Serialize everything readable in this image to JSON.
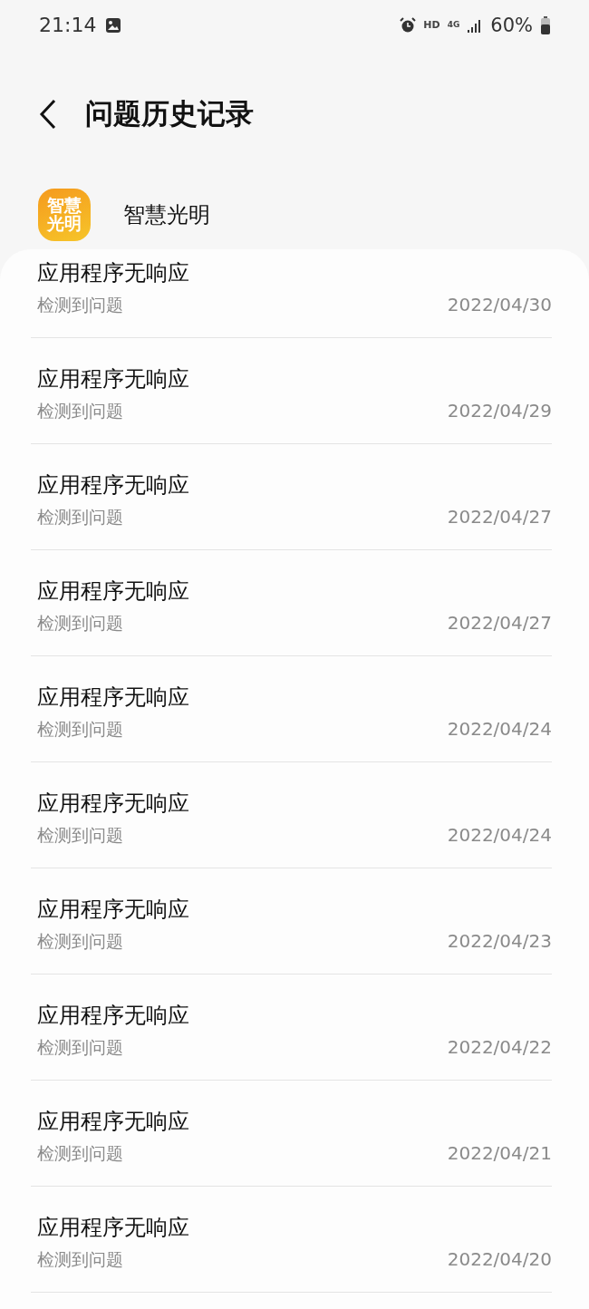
{
  "status_bar": {
    "time": "21:14",
    "network": "HD",
    "network_type": "4G",
    "battery": "60%"
  },
  "header": {
    "title": "问题历史记录"
  },
  "app": {
    "icon_lines": [
      "智慧",
      "光明"
    ],
    "name": "智慧光明"
  },
  "records": [
    {
      "title": "应用程序无响应",
      "subtitle": "检测到问题",
      "date": "2022/04/30"
    },
    {
      "title": "应用程序无响应",
      "subtitle": "检测到问题",
      "date": "2022/04/29"
    },
    {
      "title": "应用程序无响应",
      "subtitle": "检测到问题",
      "date": "2022/04/27"
    },
    {
      "title": "应用程序无响应",
      "subtitle": "检测到问题",
      "date": "2022/04/27"
    },
    {
      "title": "应用程序无响应",
      "subtitle": "检测到问题",
      "date": "2022/04/24"
    },
    {
      "title": "应用程序无响应",
      "subtitle": "检测到问题",
      "date": "2022/04/24"
    },
    {
      "title": "应用程序无响应",
      "subtitle": "检测到问题",
      "date": "2022/04/23"
    },
    {
      "title": "应用程序无响应",
      "subtitle": "检测到问题",
      "date": "2022/04/22"
    },
    {
      "title": "应用程序无响应",
      "subtitle": "检测到问题",
      "date": "2022/04/21"
    },
    {
      "title": "应用程序无响应",
      "subtitle": "检测到问题",
      "date": "2022/04/20"
    }
  ]
}
